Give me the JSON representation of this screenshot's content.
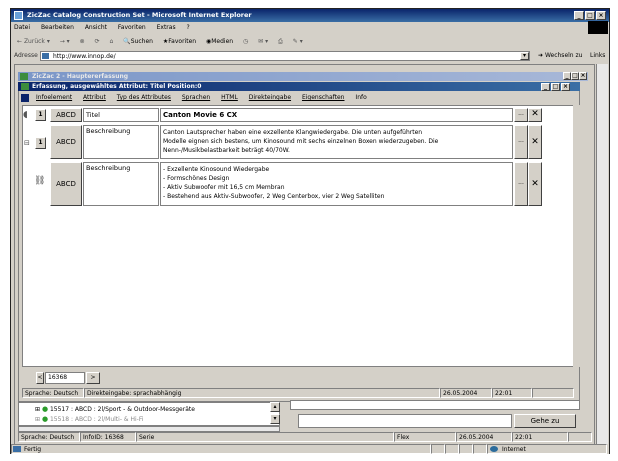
{
  "ie": {
    "title": "ZicZac Catalog Construction Set - Microsoft Internet Explorer",
    "menu": [
      "Datei",
      "Bearbeiten",
      "Ansicht",
      "Favoriten",
      "Extras",
      "?"
    ],
    "toolbar": {
      "back": "Zurück",
      "search": "Suchen",
      "favorites": "Favoriten",
      "media": "Medien"
    },
    "address_label": "Adresse",
    "address": "http://www.innop.de/",
    "go_label": "Wechseln zu",
    "links_label": "Links",
    "status_left": "Fertig",
    "status_zone": "Internet"
  },
  "app": {
    "title": "ZicZac 2 - Hauptererfassung"
  },
  "dialog": {
    "title": "Erfassung, ausgewähltes Attribut: Titel Position:0",
    "menu": [
      "Infoelement",
      "Attribut",
      "Typ des Attributes",
      "Sprachen",
      "HTML",
      "Direkteingabe",
      "Eigenschaften",
      "Info"
    ],
    "rows": [
      {
        "btn": "1",
        "abcd": "ABCD",
        "label": "Titel",
        "value": "Canton Movie 6 CX"
      },
      {
        "btn": "1",
        "abcd": "ABCD",
        "label": "Beschreibung",
        "lines": [
          "Canton Lautsprecher haben eine exzellente Klangwiedergabe. Die unten aufgeführten",
          "Modelle eignen sich bestens, um Kinosound mit sechs einzelnen Boxen wiederzugeben. Die",
          "Nenn-/Musikbelastbarkeit beträgt 40/70W."
        ]
      },
      {
        "btn": "",
        "abcd": "ABCD",
        "label": "Beschreibung",
        "lines": [
          "- Exzellente Kinosound Wiedergabe",
          "- Formschönes Design",
          "- Aktiv Subwoofer mit 16,5 cm Membran",
          "- Bestehend aus Aktiv-Subwoofer, 2 Weg Centerbox, vier 2 Weg Satelliten"
        ]
      }
    ],
    "ellipsis": "...",
    "delete_glyph": "✕",
    "nav_value": "16368",
    "status": {
      "lang": "Sprache: Deutsch",
      "direct": "Direkteingabe: sprachabhängig",
      "date": "26.05.2004",
      "time": "22:01"
    }
  },
  "tree": {
    "items": [
      "15517 : ABCD : 2l/Sport - & Outdoor-Messgeräte",
      "15518 : ABCD : 2l/Multi- & Hi-Fi"
    ]
  },
  "bottom": {
    "goto_label": "Gehe zu",
    "status": {
      "lang": "Sprache: Deutsch",
      "info": "InfoID: 16368",
      "serie": "Serie",
      "flex": "Flex",
      "date": "26.05.2004",
      "time": "22:01"
    }
  }
}
